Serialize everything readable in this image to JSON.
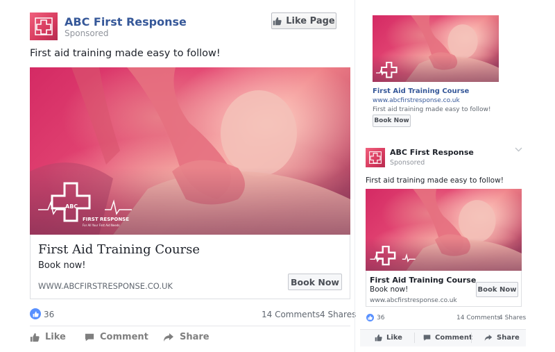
{
  "main_post": {
    "page_name": "ABC First Response",
    "sponsored": "Sponsored",
    "like_page_label": "Like Page",
    "post_text": "First aid training made easy to follow!",
    "image_logo_title": "ABC",
    "image_logo_name": "FIRST RESPONSE",
    "image_logo_tagline": "For All Your First Aid Needs",
    "headline": "First Aid Training Course",
    "description": "Book now!",
    "url": "WWW.ABCFIRSTRESPONSE.CO.UK",
    "cta_label": "Book Now",
    "likes_count": "36",
    "comments": "14 Comments",
    "shares": "4 Shares",
    "actions": {
      "like": "Like",
      "comment": "Comment",
      "share": "Share"
    }
  },
  "right_column_ad": {
    "headline": "First Aid Training Course",
    "url": "www.abcfirstresponse.co.uk",
    "description": "First aid training made easy to follow!",
    "cta_label": "Book Now"
  },
  "mobile_post": {
    "page_name": "ABC First Response",
    "sponsored": "Sponsored",
    "post_text": "First aid training made easy to follow!",
    "headline": "First Aid Training Course",
    "description": "Book now!",
    "url": "www.abcfirstresponse.co.uk",
    "cta_label": "Book Now",
    "likes_count": "36",
    "comments": "14 Comments",
    "shares": "4 Shares",
    "actions": {
      "like": "Like",
      "comment": "Comment",
      "share": "Share"
    }
  },
  "colors": {
    "page_name": "#365899",
    "like_blue": "#5890ff",
    "brand_pink": "#e0386b"
  },
  "icons": [
    "cross-logo-icon",
    "thumbs-up-icon",
    "comment-icon",
    "share-icon",
    "chevron-down-icon"
  ]
}
